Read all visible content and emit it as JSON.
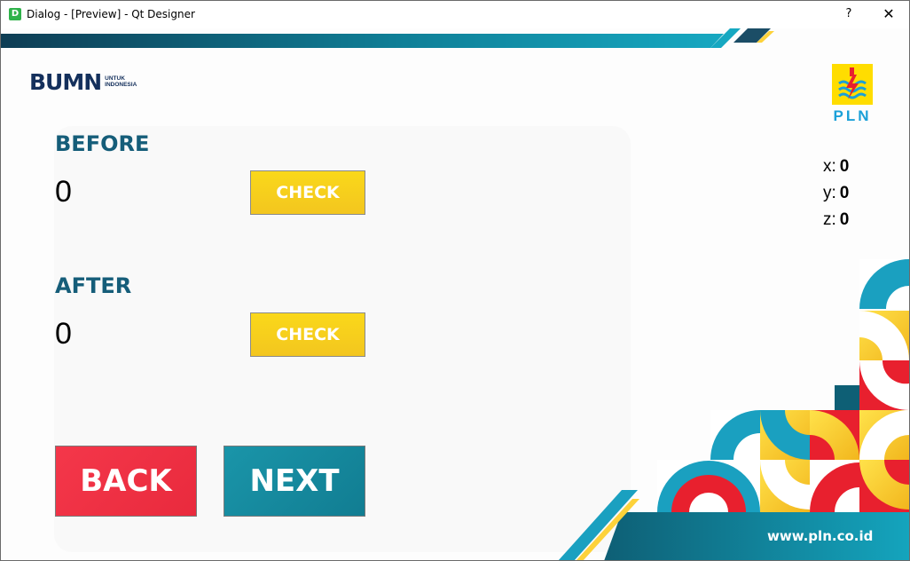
{
  "window": {
    "title": "Dialog - [Preview] - Qt Designer",
    "app_icon_letter": "D",
    "help_label": "?",
    "close_label": "✕"
  },
  "logos": {
    "bumn": {
      "main": "BUMN",
      "sub_line1": "UNTUK",
      "sub_line2": "INDONESIA"
    },
    "pln": {
      "text": "PLN"
    }
  },
  "before": {
    "label": "BEFORE",
    "value": "0",
    "check_label": "CHECK"
  },
  "after": {
    "label": "AFTER",
    "value": "0",
    "check_label": "CHECK"
  },
  "coords": {
    "x_label": "x:",
    "x_value": "0",
    "y_label": "y:",
    "y_value": "0",
    "z_label": "z:",
    "z_value": "0"
  },
  "nav": {
    "back_label": "BACK",
    "next_label": "NEXT"
  },
  "footer": {
    "website": "www.pln.co.id"
  },
  "colors": {
    "label_teal": "#155d79",
    "check_yellow": "#f5c91e",
    "back_red": "#ee3043",
    "next_teal": "#138598",
    "accent_yellow": "#fdd23a",
    "accent_red": "#e8202e"
  },
  "icons": [
    "app-icon",
    "help-icon",
    "close-icon",
    "pln-lightning-icon"
  ]
}
